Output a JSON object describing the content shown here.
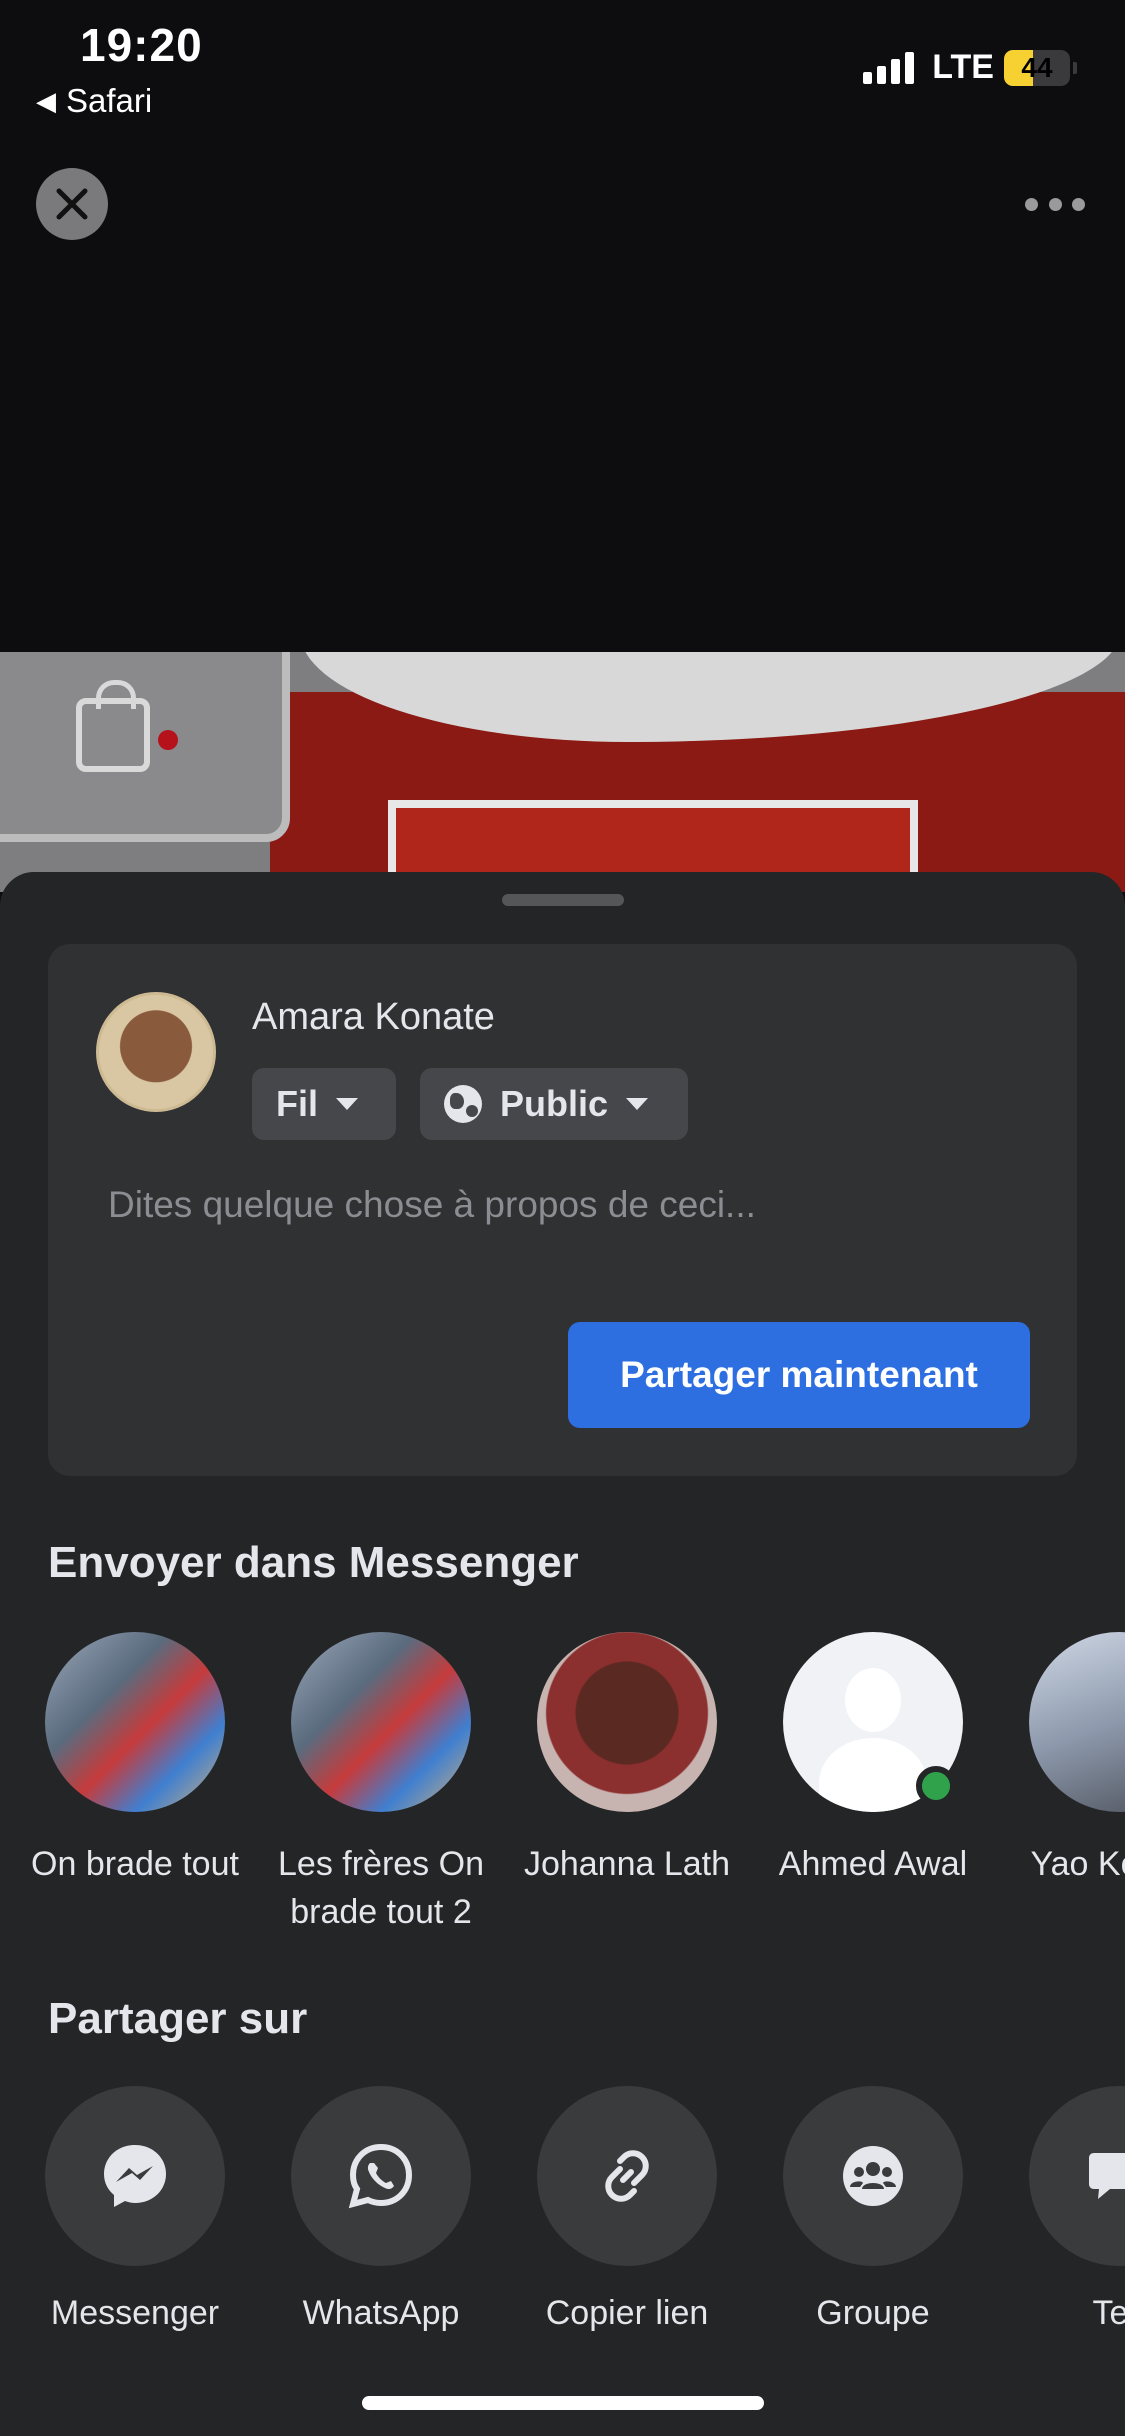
{
  "status_bar": {
    "time": "19:20",
    "back_app": "Safari",
    "network": "LTE",
    "battery": "44",
    "battery_level": 0.44
  },
  "viewer": {
    "close_icon": "close-icon",
    "more_icon": "more-horizontal-icon"
  },
  "composer": {
    "user_name": "Amara Konate",
    "audience_feed": "Fil",
    "privacy": "Public",
    "placeholder": "Dites quelque chose à propos de ceci...",
    "share_button": "Partager maintenant"
  },
  "messenger": {
    "title": "Envoyer dans Messenger",
    "contacts": [
      {
        "name": "On brade tout"
      },
      {
        "name": "Les frères On brade tout 2"
      },
      {
        "name": "Johanna Lath"
      },
      {
        "name": "Ahmed Awal",
        "online": true
      },
      {
        "name": "Yao Ko Kev"
      }
    ]
  },
  "share_on": {
    "title": "Partager sur",
    "targets": [
      {
        "label": "Messenger",
        "icon": "messenger-icon"
      },
      {
        "label": "WhatsApp",
        "icon": "whatsapp-icon"
      },
      {
        "label": "Copier lien",
        "icon": "link-icon"
      },
      {
        "label": "Groupe",
        "icon": "group-icon"
      },
      {
        "label": "Tex",
        "icon": "text-message-icon"
      }
    ]
  },
  "colors": {
    "sheet_bg": "#242526",
    "card_bg": "#303133",
    "primary_button": "#2d6fe0",
    "online_dot": "#31a24c",
    "battery_fill": "#f6d131"
  }
}
